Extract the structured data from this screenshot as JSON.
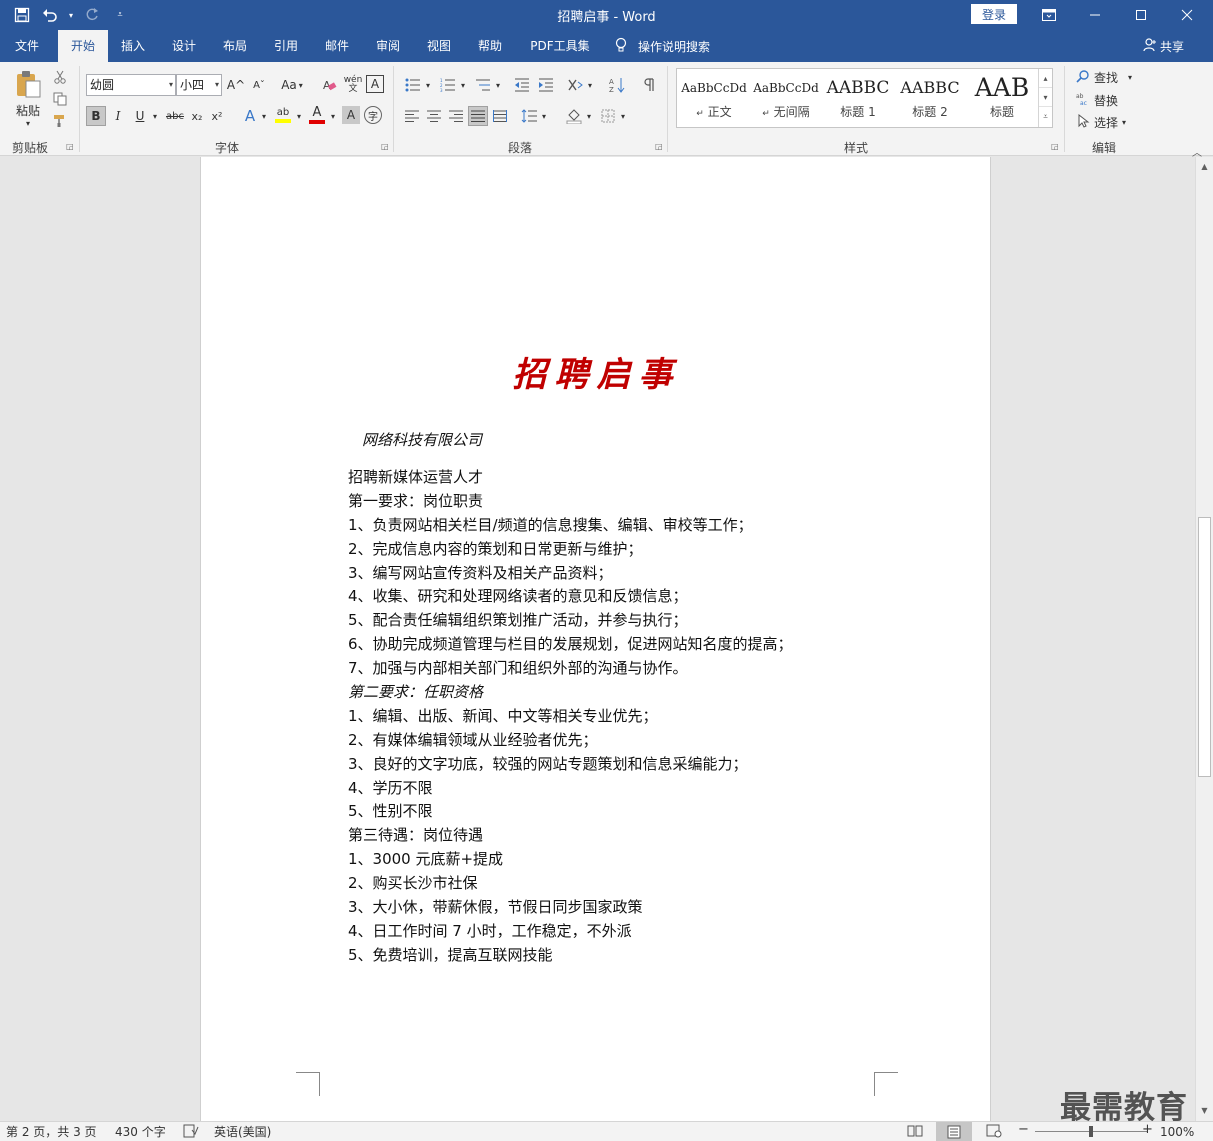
{
  "window": {
    "title": "招聘启事 - Word",
    "login": "登录"
  },
  "tabs": [
    "文件",
    "开始",
    "插入",
    "设计",
    "布局",
    "引用",
    "邮件",
    "审阅",
    "视图",
    "帮助",
    "PDF工具集"
  ],
  "active_tab": "开始",
  "tell_me": "操作说明搜索",
  "share": "共享",
  "ribbon": {
    "clipboard": {
      "label": "剪贴板",
      "paste": "粘贴"
    },
    "font": {
      "label": "字体",
      "family": "幼圆",
      "size": "小四",
      "bold": "B",
      "italic": "I",
      "underline": "U",
      "strike": "abc",
      "subscript": "x₂",
      "superscript": "x²",
      "grow": "A^",
      "shrink": "Aˇ",
      "change_case": "Aa",
      "phonetic": "wén",
      "char_border": "A",
      "text_effect": "A",
      "highlight": "ab",
      "font_color": "A",
      "char_shading": "A",
      "enclose": "字"
    },
    "paragraph": {
      "label": "段落"
    },
    "styles": {
      "label": "样式",
      "items": [
        {
          "sample": "AaBbCcDd",
          "name": "正文"
        },
        {
          "sample": "AaBbCcDd",
          "name": "无间隔"
        },
        {
          "sample": "AABBC",
          "name": "标题 1"
        },
        {
          "sample": "AABBC",
          "name": "标题 2"
        },
        {
          "sample": "AAB",
          "name": "标题"
        }
      ]
    },
    "editing": {
      "label": "编辑",
      "find": "查找",
      "replace": "替换",
      "select": "选择"
    }
  },
  "document": {
    "title": "招聘启事",
    "company": "网络科技有限公司",
    "lines": [
      {
        "text": "招聘新媒体运营人才",
        "italic": false
      },
      {
        "text": "第一要求：岗位职责",
        "italic": false
      },
      {
        "text": "1、负责网站相关栏目/频道的信息搜集、编辑、审校等工作；",
        "italic": false
      },
      {
        "text": "2、完成信息内容的策划和日常更新与维护；",
        "italic": false
      },
      {
        "text": "3、编写网站宣传资料及相关产品资料；",
        "italic": false
      },
      {
        "text": "4、收集、研究和处理网络读者的意见和反馈信息；",
        "italic": false
      },
      {
        "text": "5、配合责任编辑组织策划推广活动，并参与执行；",
        "italic": false
      },
      {
        "text": "6、协助完成频道管理与栏目的发展规划，促进网站知名度的提高；",
        "italic": false
      },
      {
        "text": "7、加强与内部相关部门和组织外部的沟通与协作。",
        "italic": false
      },
      {
        "text": "第二要求：任职资格",
        "italic": true
      },
      {
        "text": "1、编辑、出版、新闻、中文等相关专业优先；",
        "italic": false
      },
      {
        "text": "2、有媒体编辑领域从业经验者优先；",
        "italic": false
      },
      {
        "text": "3、良好的文字功底，较强的网站专题策划和信息采编能力；",
        "italic": false
      },
      {
        "text": "4、学历不限",
        "italic": false
      },
      {
        "text": "5、性别不限",
        "italic": false
      },
      {
        "text": "第三待遇：岗位待遇",
        "italic": false
      },
      {
        "text": "1、3000 元底薪+提成",
        "italic": false
      },
      {
        "text": "2、购买长沙市社保",
        "italic": false
      },
      {
        "text": "3、大小休，带薪休假，节假日同步国家政策",
        "italic": false
      },
      {
        "text": "4、日工作时间 7 小时，工作稳定，不外派",
        "italic": false
      },
      {
        "text": "5、免费培训，提高互联网技能",
        "italic": false
      }
    ]
  },
  "status": {
    "page": "第 2 页，共 3 页",
    "words": "430 个字",
    "language": "英语(美国)",
    "zoom": "100%",
    "zoom_fraction": 0.5
  },
  "watermark": "最需教育",
  "colors": {
    "accent": "#2b579a",
    "title_red": "#c00000"
  }
}
